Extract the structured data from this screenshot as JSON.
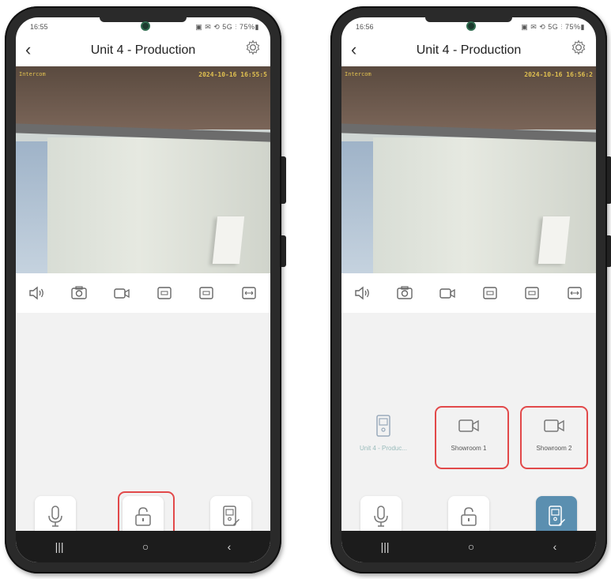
{
  "phones": [
    {
      "status": {
        "time": "16:55",
        "icons": "▣ ✉ ⟲ 5G ⫶ 75%▮"
      },
      "header": {
        "title": "Unit 4 - Production"
      },
      "video": {
        "osd_name": "Intercom",
        "osd_timestamp": "2024-10-16 16:55:5"
      }
    },
    {
      "status": {
        "time": "16:56",
        "icons": "▣ ✉ ⟲ 5G ⫶ 75%▮"
      },
      "header": {
        "title": "Unit 4 - Production"
      },
      "video": {
        "osd_name": "Intercom",
        "osd_timestamp": "2024-10-16 16:56:2"
      },
      "devices": [
        {
          "label": "Unit 4 - Produc..."
        },
        {
          "label": "Showroom 1"
        },
        {
          "label": "Showroom 2"
        }
      ]
    }
  ],
  "icons": {
    "back": "chevron-left-icon",
    "settings": "gear-icon",
    "toolbar": [
      "speaker-icon",
      "snapshot-icon",
      "record-icon",
      "sd-icon",
      "hd-icon",
      "fullscreen-icon"
    ],
    "actions": [
      "microphone-icon",
      "unlock-icon",
      "door-station-icon"
    ],
    "nav": [
      "recent-apps-icon",
      "home-icon",
      "back-icon"
    ]
  },
  "colors": {
    "highlight": "#e2494a",
    "active_button": "#5b8fb0",
    "osd_text": "#e0c050"
  }
}
